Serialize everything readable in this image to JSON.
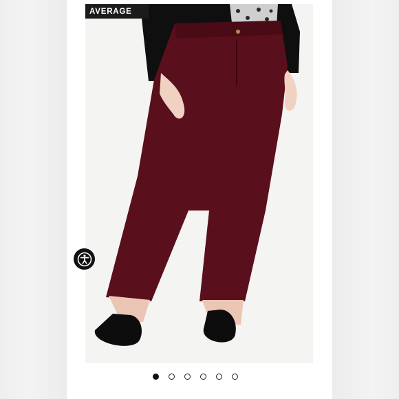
{
  "badge": {
    "label": "AVERAGE"
  },
  "product": {
    "pants_color": "#5a0f1c",
    "background_color": "#f4f4f2"
  },
  "accessibility": {
    "icon": "accessibility-icon"
  },
  "carousel": {
    "total": 6,
    "active_index": 0
  }
}
